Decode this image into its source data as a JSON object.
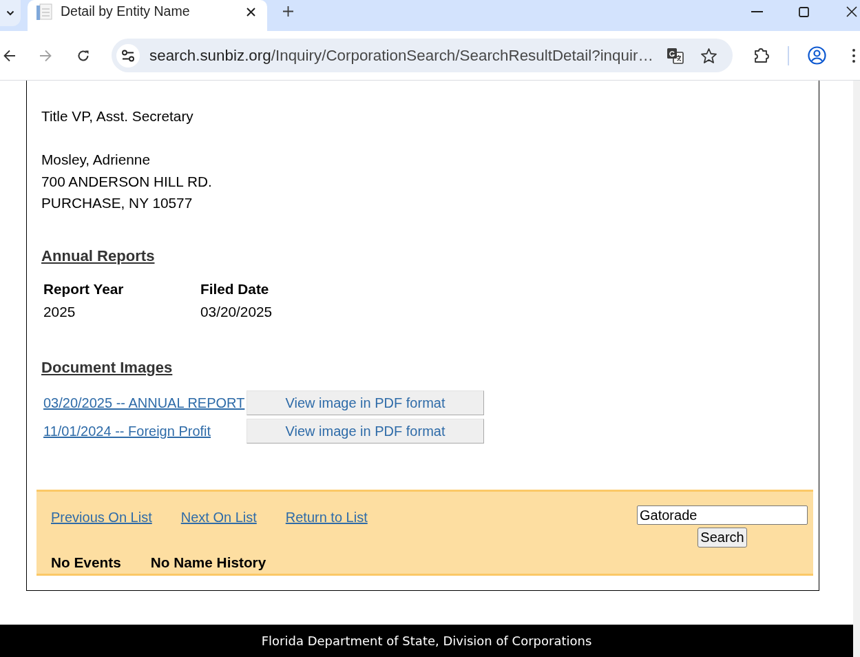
{
  "browser": {
    "tabs": [
      {
        "title": "Detail by Entity Name",
        "selected": true
      }
    ],
    "address_bar": {
      "host": "search.sunbiz.org",
      "path": "/Inquiry/CorporationSearch/SearchResultDetail?inquir…"
    }
  },
  "officer": {
    "title": "Title VP, Asst. Secretary",
    "name": "Mosley, Adrienne",
    "address": [
      "700 ANDERSON HILL RD.",
      "PURCHASE, NY 10577"
    ]
  },
  "annual_reports": {
    "heading": "Annual Reports",
    "columns": [
      "Report Year",
      "Filed Date"
    ],
    "rows": [
      [
        "2025",
        "03/20/2025"
      ]
    ]
  },
  "document_images": {
    "heading": "Document Images",
    "rows": [
      {
        "link": "03/20/2025 -- ANNUAL REPORT",
        "button": "View image in PDF format"
      },
      {
        "link": "11/01/2024 -- Foreign Profit",
        "button": "View image in PDF format"
      }
    ]
  },
  "navigation": {
    "links": [
      "Previous On List",
      "Next On List",
      "Return to List"
    ],
    "search_field": {
      "value": "Gatorade"
    },
    "search_button": "Search",
    "notes": [
      "No Events",
      "No Name History"
    ]
  },
  "footer": {
    "text": "Florida Department of State, Division of Corporations"
  }
}
